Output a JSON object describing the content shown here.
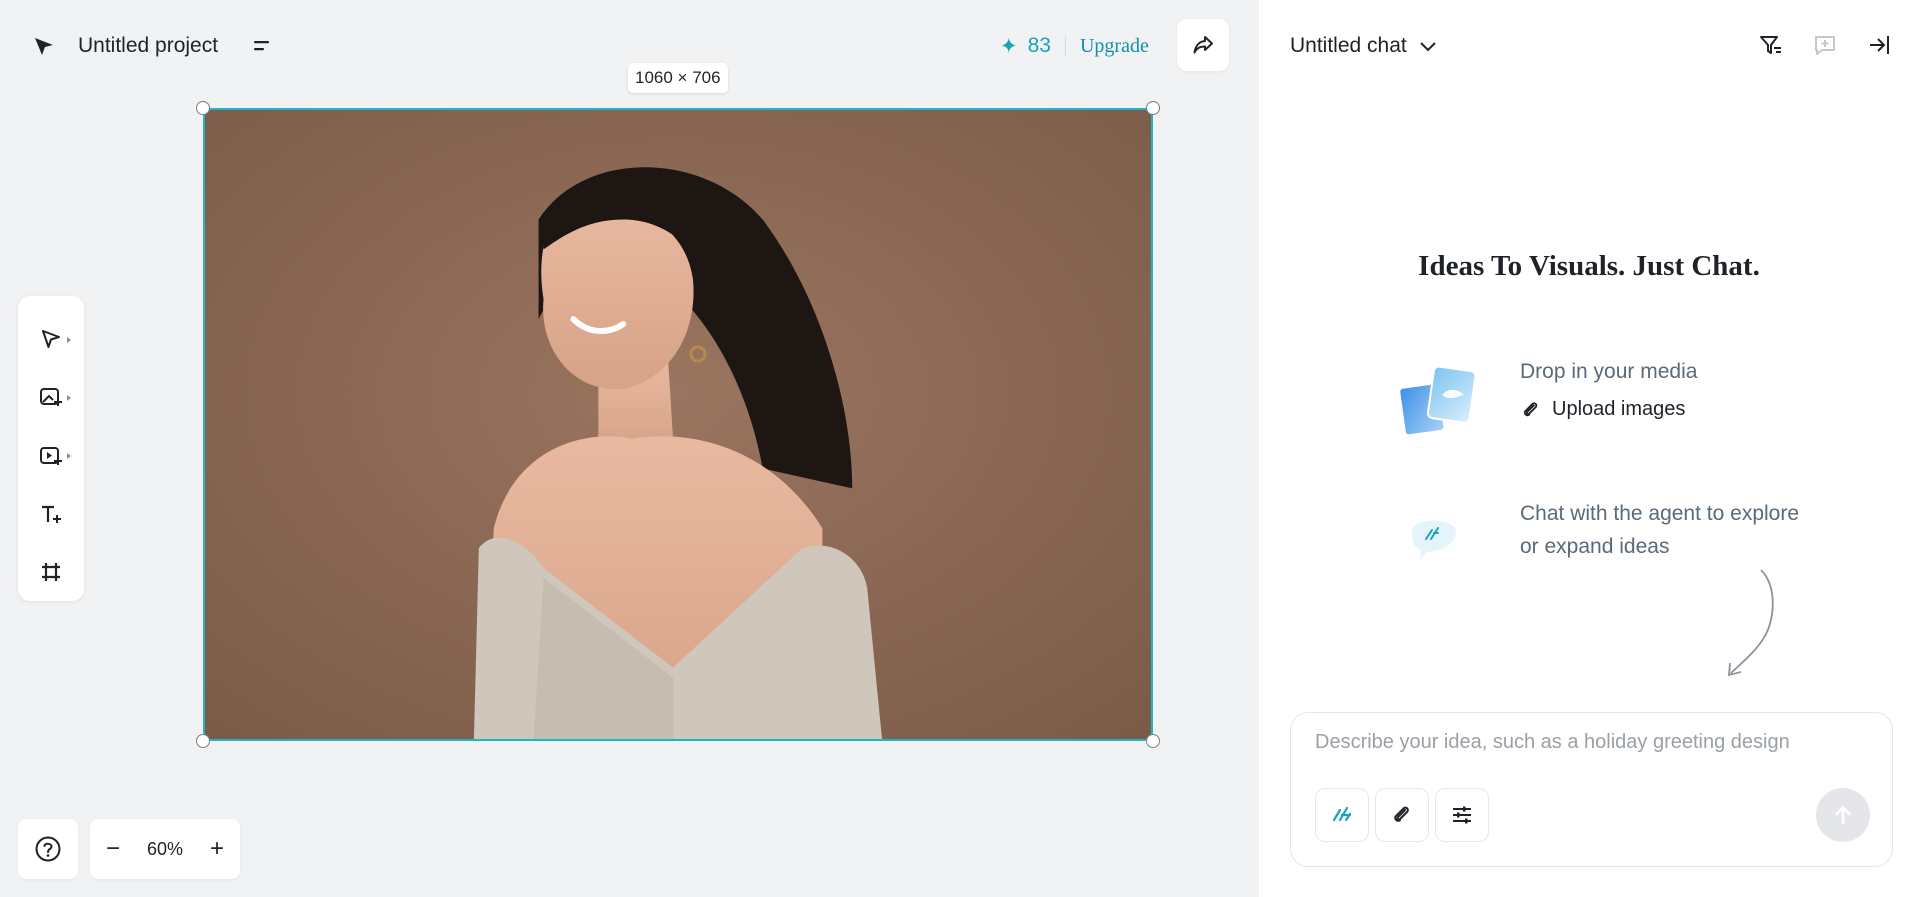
{
  "app": {
    "project_title": "Untitled project",
    "credits": "83",
    "upgrade_label": "Upgrade"
  },
  "canvas": {
    "dimensions_label": "1060 × 706",
    "zoom_level": "60%",
    "zoom_out_label": "−",
    "zoom_in_label": "+"
  },
  "toolbar": {
    "tools": [
      "select-tool",
      "image-tool",
      "video-tool",
      "text-tool",
      "frame-tool"
    ]
  },
  "chat": {
    "title": "Untitled chat",
    "hero_title": "Ideas To Visuals. Just Chat.",
    "feature_media_desc": "Drop in your media",
    "upload_label": "Upload images",
    "feature_agent_line1": "Chat with the agent to explore",
    "feature_agent_line2": "or expand ideas",
    "input_placeholder": "Describe your idea, such as a holiday greeting design"
  },
  "colors": {
    "accent": "#1aa3b8",
    "selection": "#20b5c5",
    "photo_background": "#8a6650"
  }
}
